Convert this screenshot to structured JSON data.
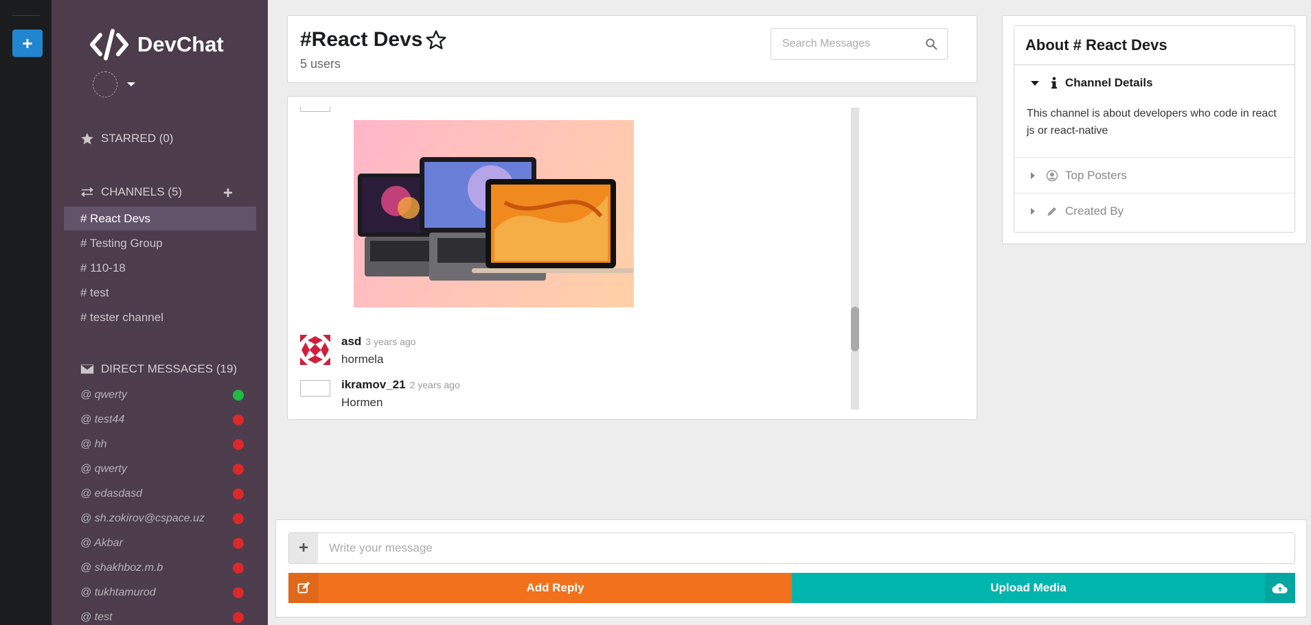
{
  "rail": {
    "add_label": "+"
  },
  "app": {
    "name": "DevChat"
  },
  "sidebar": {
    "starred_label": "STARRED (0)",
    "channels_label": "CHANNELS (5)",
    "channels": [
      "# React Devs",
      "# Testing Group",
      "# 110-18",
      "# test",
      "# tester channel"
    ],
    "active_channel_index": 0,
    "dm_label": "DIRECT MESSAGES (19)",
    "direct_messages": [
      {
        "name": "@ qwerty",
        "status": "online"
      },
      {
        "name": "@ test44",
        "status": "offline"
      },
      {
        "name": "@ hh",
        "status": "offline"
      },
      {
        "name": "@ qwerty",
        "status": "offline"
      },
      {
        "name": "@ edasdasd",
        "status": "offline"
      },
      {
        "name": "@ sh.zokirov@cspace.uz",
        "status": "offline"
      },
      {
        "name": "@ Akbar",
        "status": "offline"
      },
      {
        "name": "@ shakhboz.m.b",
        "status": "offline"
      },
      {
        "name": "@ tukhtamurod",
        "status": "offline"
      },
      {
        "name": "@ test",
        "status": "offline"
      }
    ]
  },
  "header": {
    "channel_title": "#React Devs",
    "user_count": "5 users",
    "search_placeholder": "Search Messages"
  },
  "messages": [
    {
      "author": "asd",
      "time": "3 years ago",
      "text": "hormela"
    },
    {
      "author": "ikramov_21",
      "time": "2 years ago",
      "text": "Hormen"
    }
  ],
  "about": {
    "title": "About # React Devs",
    "details_label": "Channel Details",
    "description": "This channel is about developers who code in react js or react-native",
    "top_posters_label": "Top Posters",
    "created_by_label": "Created By"
  },
  "composer": {
    "placeholder": "Write your message",
    "reply_label": "Add Reply",
    "upload_label": "Upload Media"
  },
  "colors": {
    "sidebar_bg": "#4c3c4c",
    "rail_bg": "#1b1c1d",
    "reply_button": "#f2711c",
    "upload_button": "#00b5ad",
    "online": "#21ba45",
    "offline": "#db2828",
    "rail_add_button": "#2185d0"
  }
}
